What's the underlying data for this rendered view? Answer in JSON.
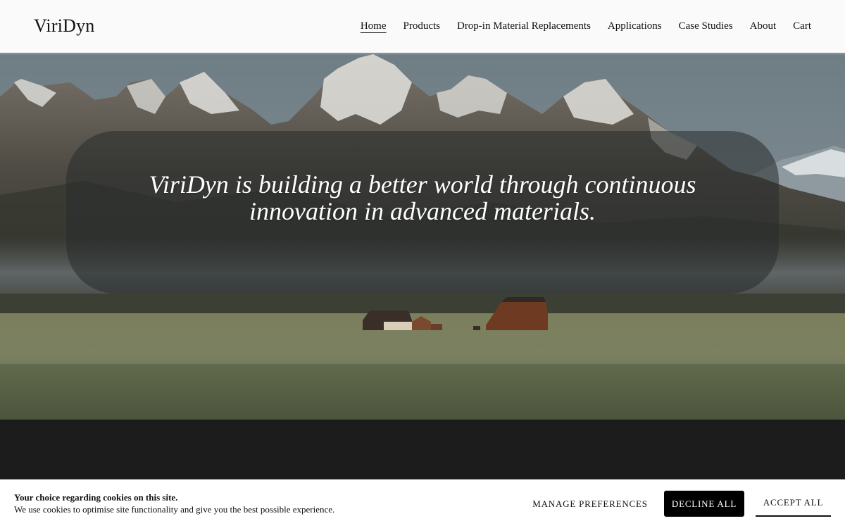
{
  "brand": {
    "name": "ViriDyn"
  },
  "nav": {
    "items": [
      {
        "label": "Home",
        "active": true
      },
      {
        "label": "Products"
      },
      {
        "label": "Drop-in Material Replacements"
      },
      {
        "label": "Applications"
      },
      {
        "label": "Case Studies"
      },
      {
        "label": "About"
      },
      {
        "label": "Cart"
      }
    ]
  },
  "hero": {
    "headline_line1": "ViriDyn is building a better world through continuous",
    "headline_line2": "innovation in advanced materials.",
    "image": "mountain-landscape-with-barns"
  },
  "cookie": {
    "title": "Your choice regarding cookies on this site.",
    "description": "We use cookies to optimise site functionality and give you the best possible experience.",
    "manage_label": "MANAGE PREFERENCES",
    "decline_label": "DECLINE ALL",
    "accept_label": "ACCEPT ALL"
  },
  "colors": {
    "header_bg": "#fafafa",
    "dark_section": "#1c1c1c",
    "decline_bg": "#000000"
  }
}
